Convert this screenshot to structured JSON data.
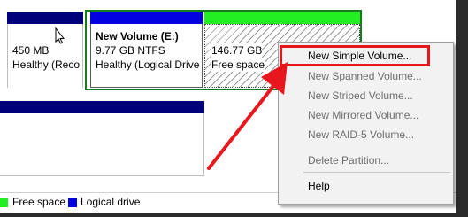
{
  "disk1": {
    "partition1": {
      "size": "450 MB",
      "status": "Healthy (Reco"
    },
    "partition2": {
      "name": "New Volume  (E:)",
      "fs": "9.77 GB NTFS",
      "status": "Healthy (Logical Drive"
    },
    "partition3": {
      "size": "146.77 GB",
      "status": "Free space"
    }
  },
  "context_menu": {
    "items": [
      {
        "label": "New Simple Volume...",
        "enabled": true
      },
      {
        "label": "New Spanned Volume...",
        "enabled": false
      },
      {
        "label": "New Striped Volume...",
        "enabled": false
      },
      {
        "label": "New Mirrored Volume...",
        "enabled": false
      },
      {
        "label": "New RAID-5 Volume...",
        "enabled": false
      },
      {
        "label": "Delete Partition...",
        "enabled": false
      },
      {
        "label": "Help",
        "enabled": true
      }
    ]
  },
  "legend": {
    "free_space": "Free space",
    "logical_drive": "Logical drive"
  },
  "colors": {
    "primary_bar": "#00007a",
    "logical_bar": "#0000e0",
    "free_bar": "#22ee22",
    "selection_frame": "#167d1f",
    "highlight": "#e8161d"
  }
}
